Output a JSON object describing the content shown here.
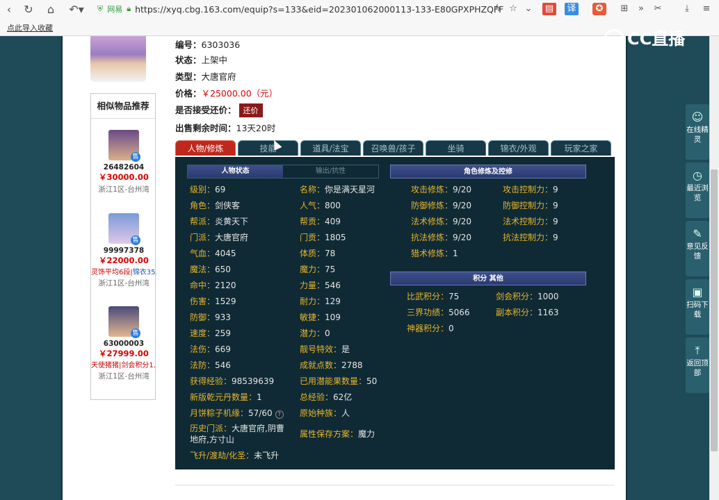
{
  "browser": {
    "secure_label": "网易",
    "url": "https://xyq.cbg.163.com/equip?s=133&eid=202301062000113-133-E80GPXPHZQFF",
    "bookmark": "点此导入收藏"
  },
  "overlay_logo": "CC直播",
  "item": {
    "id_label": "编号：",
    "id_value": "6303036",
    "status_label": "状态：",
    "status_value": "上架中",
    "type_label": "类型：",
    "type_value": "大唐官府",
    "price_label": "价格：",
    "price_value": "￥25000.00（元）",
    "haggle_label": "是否接受还价：",
    "haggle_button": "还价",
    "time_label": "出售剩余时间：",
    "time_value": "13天20时"
  },
  "similar": {
    "title": "相似物品推荐",
    "items": [
      {
        "id": "26482604",
        "price": "￥30000.00",
        "extra": "",
        "extra_b": "",
        "server": "浙江1区-台州湾",
        "badge": "售"
      },
      {
        "id": "99997378",
        "price": "￥22000.00",
        "extra": "灵饰平均6段",
        "extra_b": "锦衣35…",
        "server": "浙江1区-台州湾",
        "badge": "售"
      },
      {
        "id": "63000003",
        "price": "￥27999.00",
        "extra": "天使猪猪",
        "extra_b": "剑会积分1…",
        "server": "浙江1区-台州湾",
        "badge": "售"
      }
    ]
  },
  "tabs": [
    "人物/修炼",
    "技能",
    "道具/法宝",
    "召唤兽/孩子",
    "坐骑",
    "锦衣/外观",
    "玩家之家"
  ],
  "sub_tabs": [
    "人物状态",
    "输出/抗性"
  ],
  "stats_left": [
    {
      "k": "级别：",
      "v": "69"
    },
    {
      "k": "角色：",
      "v": "剑侠客"
    },
    {
      "k": "帮派：",
      "v": "炎黄天下"
    },
    {
      "k": "门派：",
      "v": "大唐官府"
    },
    {
      "k": "气血：",
      "v": "4045"
    },
    {
      "k": "魔法：",
      "v": "650"
    },
    {
      "k": "命中：",
      "v": "2120"
    },
    {
      "k": "伤害：",
      "v": "1529"
    },
    {
      "k": "防御：",
      "v": "933"
    },
    {
      "k": "速度：",
      "v": "259"
    },
    {
      "k": "法伤：",
      "v": "669"
    },
    {
      "k": "法防：",
      "v": "546"
    },
    {
      "k": "获得经验：",
      "v": "98539639"
    },
    {
      "k": "新版乾元丹数量：",
      "v": "1"
    },
    {
      "k": "月饼粽子机缘：",
      "v": "57/60"
    },
    {
      "k": "历史门派：",
      "v": "大唐官府,阴曹"
    },
    {
      "k": "",
      "v": "地府,方寸山"
    },
    {
      "k": "飞升/渡劫/化圣：",
      "v": "未飞升"
    }
  ],
  "stats_mid": [
    {
      "k": "名称：",
      "v": "你是满天星河"
    },
    {
      "k": "人气：",
      "v": "800"
    },
    {
      "k": "帮贡：",
      "v": "409"
    },
    {
      "k": "门贡：",
      "v": "1805"
    },
    {
      "k": "体质：",
      "v": "78"
    },
    {
      "k": "魔力：",
      "v": "75"
    },
    {
      "k": "力量：",
      "v": "546"
    },
    {
      "k": "耐力：",
      "v": "129"
    },
    {
      "k": "敏捷：",
      "v": "109"
    },
    {
      "k": "潜力：",
      "v": "0"
    },
    {
      "k": "靓号特效：",
      "v": "是"
    },
    {
      "k": "成就点数：",
      "v": "2788"
    },
    {
      "k": "已用潜能果数量：",
      "v": "50"
    },
    {
      "k": "总经验：",
      "v": "62亿"
    },
    {
      "k": "原始种族：",
      "v": "人"
    },
    {
      "k": "属性保存方案：",
      "v": "魔力"
    }
  ],
  "cultivation": {
    "title": "角色修炼及控修",
    "rows": [
      {
        "k1": "攻击修炼：",
        "v1": "9/20",
        "k2": "攻击控制力：",
        "v2": "9"
      },
      {
        "k1": "防御修炼：",
        "v1": "9/20",
        "k2": "防御控制力：",
        "v2": "9"
      },
      {
        "k1": "法术修炼：",
        "v1": "9/20",
        "k2": "法术控制力：",
        "v2": "9"
      },
      {
        "k1": "抗法修炼：",
        "v1": "9/20",
        "k2": "抗法控制力：",
        "v2": "9"
      },
      {
        "k1": "猎术修炼：",
        "v1": "1",
        "k2": "",
        "v2": ""
      }
    ]
  },
  "points": {
    "title": "积分 其他",
    "rows": [
      {
        "k1": "比武积分：",
        "v1": "75",
        "k2": "剑会积分：",
        "v2": "1000"
      },
      {
        "k1": "三界功绩：",
        "v1": "5066",
        "k2": "副本积分：",
        "v2": "1163"
      },
      {
        "k1": "神器积分：",
        "v1": "0",
        "k2": "",
        "v2": ""
      }
    ]
  },
  "side_tools": [
    {
      "icon": "☺",
      "label": "在线精灵"
    },
    {
      "icon": "◷",
      "label": "最近浏览"
    },
    {
      "icon": "✎",
      "label": "意见反馈"
    },
    {
      "icon": "▣",
      "label": "扫码下载"
    },
    {
      "icon": "⤒",
      "label": "返回顶部"
    }
  ]
}
